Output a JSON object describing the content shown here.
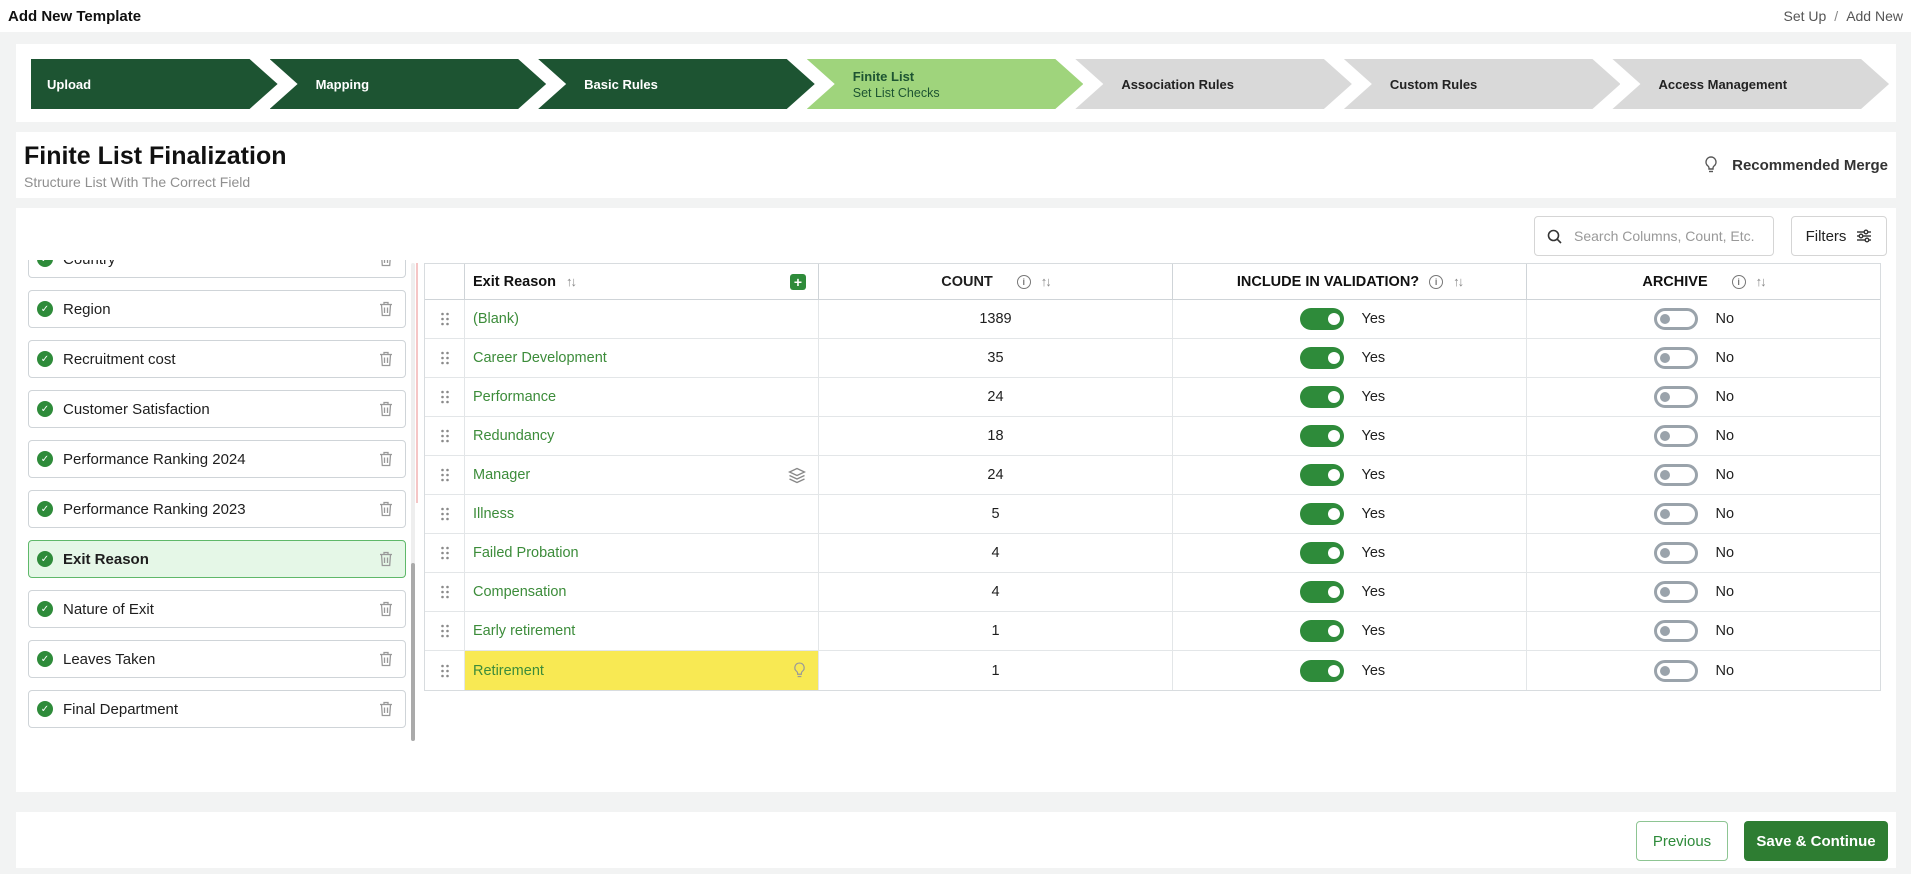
{
  "header": {
    "title": "Add New Template",
    "breadcrumb": [
      "Set Up",
      "Add New"
    ],
    "breadcrumb_separator": "/"
  },
  "stepper": [
    {
      "label": "Upload",
      "sub": "",
      "state": "done"
    },
    {
      "label": "Mapping",
      "sub": "",
      "state": "done"
    },
    {
      "label": "Basic Rules",
      "sub": "",
      "state": "done"
    },
    {
      "label": "Finite List",
      "sub": "Set List Checks",
      "state": "active"
    },
    {
      "label": "Association Rules",
      "sub": "",
      "state": "todo"
    },
    {
      "label": "Custom Rules",
      "sub": "",
      "state": "todo"
    },
    {
      "label": "Access Management",
      "sub": "",
      "state": "todo"
    }
  ],
  "page": {
    "title": "Finite List Finalization",
    "subtitle": "Structure List With The Correct Field",
    "merge_label": "Recommended Merge"
  },
  "fields": [
    {
      "name": "Country",
      "selected": false
    },
    {
      "name": "Region",
      "selected": false
    },
    {
      "name": "Recruitment cost",
      "selected": false
    },
    {
      "name": "Customer Satisfaction",
      "selected": false
    },
    {
      "name": "Performance Ranking 2024",
      "selected": false
    },
    {
      "name": "Performance Ranking 2023",
      "selected": false
    },
    {
      "name": "Exit Reason",
      "selected": true
    },
    {
      "name": "Nature of Exit",
      "selected": false
    },
    {
      "name": "Leaves Taken",
      "selected": false
    },
    {
      "name": "Final Department",
      "selected": false
    }
  ],
  "search": {
    "placeholder": "Search Columns, Count, Etc."
  },
  "filters_label": "Filters",
  "table": {
    "headers": {
      "name": "Exit Reason",
      "count": "COUNT",
      "validation": "INCLUDE IN VALIDATION?",
      "archive": "ARCHIVE"
    },
    "rows": [
      {
        "name": "(Blank)",
        "count": "1389",
        "include": true,
        "include_label": "Yes",
        "archive": false,
        "archive_label": "No",
        "icon": "",
        "highlight": false
      },
      {
        "name": "Career Development",
        "count": "35",
        "include": true,
        "include_label": "Yes",
        "archive": false,
        "archive_label": "No",
        "icon": "",
        "highlight": false
      },
      {
        "name": "Performance",
        "count": "24",
        "include": true,
        "include_label": "Yes",
        "archive": false,
        "archive_label": "No",
        "icon": "",
        "highlight": false
      },
      {
        "name": "Redundancy",
        "count": "18",
        "include": true,
        "include_label": "Yes",
        "archive": false,
        "archive_label": "No",
        "icon": "",
        "highlight": false
      },
      {
        "name": "Manager",
        "count": "24",
        "include": true,
        "include_label": "Yes",
        "archive": false,
        "archive_label": "No",
        "icon": "layers-icon",
        "highlight": false
      },
      {
        "name": "Illness",
        "count": "5",
        "include": true,
        "include_label": "Yes",
        "archive": false,
        "archive_label": "No",
        "icon": "",
        "highlight": false
      },
      {
        "name": "Failed Probation",
        "count": "4",
        "include": true,
        "include_label": "Yes",
        "archive": false,
        "archive_label": "No",
        "icon": "",
        "highlight": false
      },
      {
        "name": "Compensation",
        "count": "4",
        "include": true,
        "include_label": "Yes",
        "archive": false,
        "archive_label": "No",
        "icon": "",
        "highlight": false
      },
      {
        "name": "Early retirement",
        "count": "1",
        "include": true,
        "include_label": "Yes",
        "archive": false,
        "archive_label": "No",
        "icon": "",
        "highlight": false
      },
      {
        "name": "Retirement",
        "count": "1",
        "include": true,
        "include_label": "Yes",
        "archive": false,
        "archive_label": "No",
        "icon": "lightbulb-icon",
        "highlight": true
      }
    ]
  },
  "footer": {
    "previous_label": "Previous",
    "save_label": "Save & Continue"
  },
  "colors": {
    "primary_dark": "#1d5432",
    "active_step": "#9fd47c",
    "accent_green": "#2e8b3a",
    "highlight_yellow": "#f8e953"
  }
}
